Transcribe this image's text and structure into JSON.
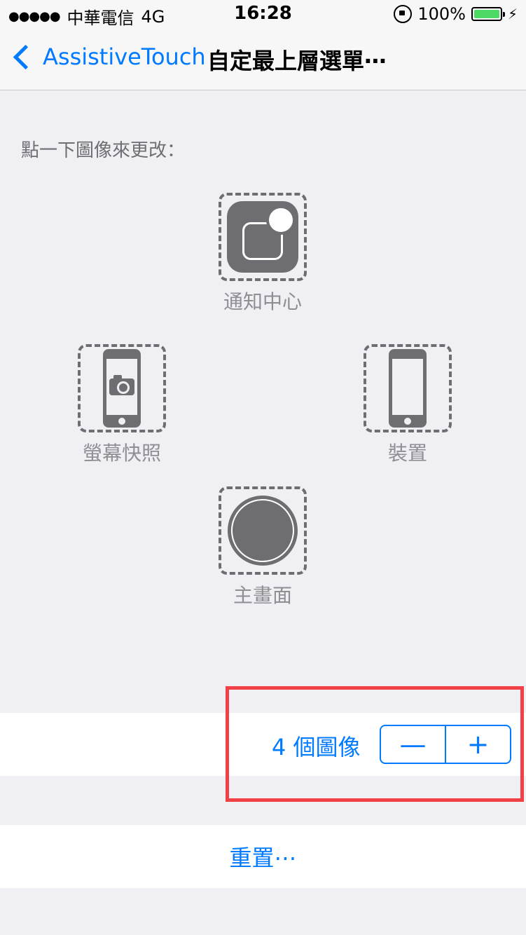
{
  "status_bar": {
    "signal": "●●●●●",
    "carrier": "中華電信",
    "network": "4G",
    "time": "16:28",
    "battery_percent": "100%",
    "battery_color": "#4cd964"
  },
  "nav": {
    "back_label": "AssistiveTouch",
    "title": "自定最上層選單⋯"
  },
  "instruction": "點一下圖像來更改：",
  "slots": {
    "top": {
      "label": "通知中心",
      "icon": "notification-center-icon"
    },
    "left": {
      "label": "螢幕快照",
      "icon": "screenshot-icon"
    },
    "right": {
      "label": "裝置",
      "icon": "device-icon"
    },
    "bottom": {
      "label": "主畫面",
      "icon": "home-icon"
    }
  },
  "count": {
    "label": "4 個圖像",
    "minus": "—",
    "plus": "+"
  },
  "reset_label": "重置⋯",
  "colors": {
    "accent": "#007aff",
    "highlight": "#ef4146",
    "icon_gray": "#6d6d72"
  }
}
